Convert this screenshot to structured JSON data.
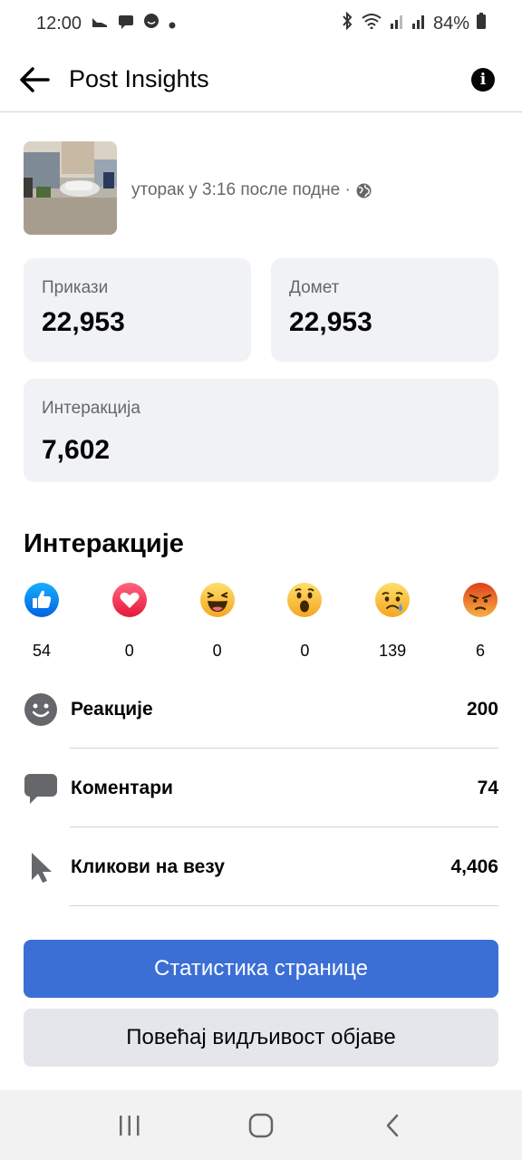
{
  "status_bar": {
    "time": "12:00",
    "battery": "84%"
  },
  "header": {
    "title": "Post Insights",
    "back_icon": "arrow-left-icon",
    "info_icon": "info-icon"
  },
  "post": {
    "time": "уторак у 3:16 после подне ·",
    "privacy_icon": "globe-icon"
  },
  "stats": [
    {
      "label": "Прикази",
      "value": "22,953"
    },
    {
      "label": "Домет",
      "value": "22,953"
    },
    {
      "label": "Интеракција",
      "value": "7,602"
    }
  ],
  "interactions": {
    "title": "Интеракције",
    "reactions": [
      {
        "icon": "like-reaction-icon",
        "count": "54"
      },
      {
        "icon": "love-reaction-icon",
        "count": "0"
      },
      {
        "icon": "haha-reaction-icon",
        "count": "0"
      },
      {
        "icon": "wow-reaction-icon",
        "count": "0"
      },
      {
        "icon": "sad-reaction-icon",
        "count": "139"
      },
      {
        "icon": "angry-reaction-icon",
        "count": "6"
      }
    ],
    "metrics": [
      {
        "icon": "smiley-icon",
        "label": "Реакције",
        "value": "200"
      },
      {
        "icon": "comment-icon",
        "label": "Коментари",
        "value": "74"
      },
      {
        "icon": "cursor-icon",
        "label": "Кликови на везу",
        "value": "4,406"
      }
    ]
  },
  "buttons": {
    "page_stats": "Статистика странице",
    "boost_post": "Повећај видљивост објаве"
  },
  "colors": {
    "primary": "#3b6fd6",
    "card_bg": "#f0f2f5",
    "secondary_btn": "#e4e6eb",
    "muted_text": "#65676b"
  }
}
